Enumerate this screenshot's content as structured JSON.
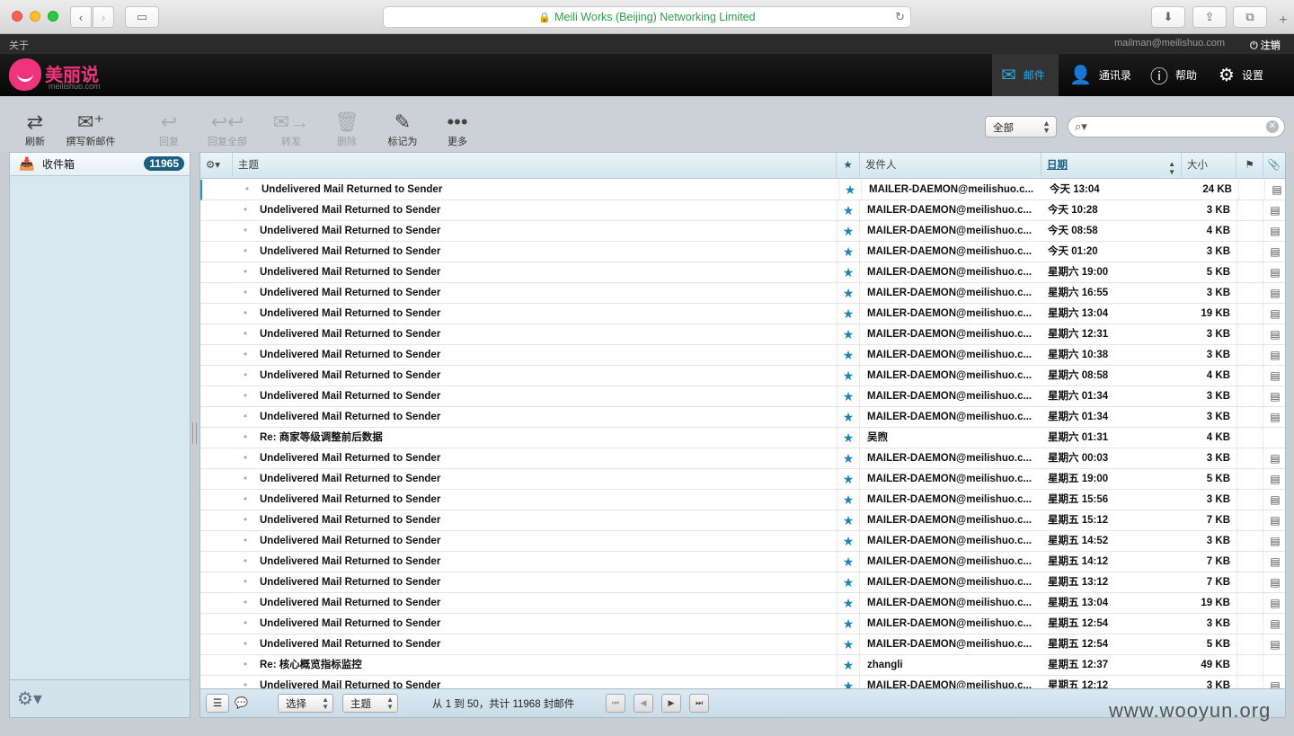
{
  "browser": {
    "url": "Meili Works (Beijing) Networking Limited",
    "back": "‹",
    "forward": "›",
    "sidebar": "▭",
    "download": "⬇",
    "share": "⇪",
    "tabs": "⧉",
    "new_tab": "+"
  },
  "account": {
    "about": "关于",
    "email": "mailman@meilishuo.com",
    "logout": "注销"
  },
  "logo": {
    "brand": "美丽说",
    "sub": "meilishuo.com"
  },
  "nav": [
    {
      "icon": "envelope-icon",
      "label": "邮件"
    },
    {
      "icon": "person-icon",
      "label": "通讯录"
    },
    {
      "icon": "help-icon",
      "label": "帮助"
    },
    {
      "icon": "gear-icon",
      "label": "设置"
    }
  ],
  "toolbar": {
    "refresh": "刷新",
    "compose": "撰写新邮件",
    "reply": "回复",
    "reply_all": "回复全部",
    "forward": "转发",
    "delete": "删除",
    "mark": "标记为",
    "more": "更多"
  },
  "filter": {
    "value": "全部"
  },
  "sidebar": {
    "folder": "收件箱",
    "count": "11965"
  },
  "list": {
    "headers": {
      "subject": "主题",
      "from": "发件人",
      "date": "日期",
      "size": "大小"
    },
    "rows": [
      {
        "subject": "Undelivered Mail Returned to Sender",
        "from": "MAILER-DAEMON@meilishuo.c...",
        "date": "今天 13:04",
        "size": "24 KB",
        "att": "▤"
      },
      {
        "subject": "Undelivered Mail Returned to Sender",
        "from": "MAILER-DAEMON@meilishuo.c...",
        "date": "今天 10:28",
        "size": "3 KB",
        "att": "▤"
      },
      {
        "subject": "Undelivered Mail Returned to Sender",
        "from": "MAILER-DAEMON@meilishuo.c...",
        "date": "今天 08:58",
        "size": "4 KB",
        "att": "▤"
      },
      {
        "subject": "Undelivered Mail Returned to Sender",
        "from": "MAILER-DAEMON@meilishuo.c...",
        "date": "今天 01:20",
        "size": "3 KB",
        "att": "▤"
      },
      {
        "subject": "Undelivered Mail Returned to Sender",
        "from": "MAILER-DAEMON@meilishuo.c...",
        "date": "星期六 19:00",
        "size": "5 KB",
        "att": "▤"
      },
      {
        "subject": "Undelivered Mail Returned to Sender",
        "from": "MAILER-DAEMON@meilishuo.c...",
        "date": "星期六 16:55",
        "size": "3 KB",
        "att": "▤"
      },
      {
        "subject": "Undelivered Mail Returned to Sender",
        "from": "MAILER-DAEMON@meilishuo.c...",
        "date": "星期六 13:04",
        "size": "19 KB",
        "att": "▤"
      },
      {
        "subject": "Undelivered Mail Returned to Sender",
        "from": "MAILER-DAEMON@meilishuo.c...",
        "date": "星期六 12:31",
        "size": "3 KB",
        "att": "▤"
      },
      {
        "subject": "Undelivered Mail Returned to Sender",
        "from": "MAILER-DAEMON@meilishuo.c...",
        "date": "星期六 10:38",
        "size": "3 KB",
        "att": "▤"
      },
      {
        "subject": "Undelivered Mail Returned to Sender",
        "from": "MAILER-DAEMON@meilishuo.c...",
        "date": "星期六 08:58",
        "size": "4 KB",
        "att": "▤"
      },
      {
        "subject": "Undelivered Mail Returned to Sender",
        "from": "MAILER-DAEMON@meilishuo.c...",
        "date": "星期六 01:34",
        "size": "3 KB",
        "att": "▤"
      },
      {
        "subject": "Undelivered Mail Returned to Sender",
        "from": "MAILER-DAEMON@meilishuo.c...",
        "date": "星期六 01:34",
        "size": "3 KB",
        "att": "▤"
      },
      {
        "subject": "Re: 商家等级调整前后数据",
        "from": "吴煦",
        "date": "星期六 01:31",
        "size": "4 KB",
        "att": ""
      },
      {
        "subject": "Undelivered Mail Returned to Sender",
        "from": "MAILER-DAEMON@meilishuo.c...",
        "date": "星期六 00:03",
        "size": "3 KB",
        "att": "▤"
      },
      {
        "subject": "Undelivered Mail Returned to Sender",
        "from": "MAILER-DAEMON@meilishuo.c...",
        "date": "星期五 19:00",
        "size": "5 KB",
        "att": "▤"
      },
      {
        "subject": "Undelivered Mail Returned to Sender",
        "from": "MAILER-DAEMON@meilishuo.c...",
        "date": "星期五 15:56",
        "size": "3 KB",
        "att": "▤"
      },
      {
        "subject": "Undelivered Mail Returned to Sender",
        "from": "MAILER-DAEMON@meilishuo.c...",
        "date": "星期五 15:12",
        "size": "7 KB",
        "att": "▤"
      },
      {
        "subject": "Undelivered Mail Returned to Sender",
        "from": "MAILER-DAEMON@meilishuo.c...",
        "date": "星期五 14:52",
        "size": "3 KB",
        "att": "▤"
      },
      {
        "subject": "Undelivered Mail Returned to Sender",
        "from": "MAILER-DAEMON@meilishuo.c...",
        "date": "星期五 14:12",
        "size": "7 KB",
        "att": "▤"
      },
      {
        "subject": "Undelivered Mail Returned to Sender",
        "from": "MAILER-DAEMON@meilishuo.c...",
        "date": "星期五 13:12",
        "size": "7 KB",
        "att": "▤"
      },
      {
        "subject": "Undelivered Mail Returned to Sender",
        "from": "MAILER-DAEMON@meilishuo.c...",
        "date": "星期五 13:04",
        "size": "19 KB",
        "att": "▤"
      },
      {
        "subject": "Undelivered Mail Returned to Sender",
        "from": "MAILER-DAEMON@meilishuo.c...",
        "date": "星期五 12:54",
        "size": "3 KB",
        "att": "▤"
      },
      {
        "subject": "Undelivered Mail Returned to Sender",
        "from": "MAILER-DAEMON@meilishuo.c...",
        "date": "星期五 12:54",
        "size": "5 KB",
        "att": "▤"
      },
      {
        "subject": "Re: 核心概览指标监控",
        "from": "zhangli",
        "date": "星期五 12:37",
        "size": "49 KB",
        "att": ""
      },
      {
        "subject": "Undelivered Mail Returned to Sender",
        "from": "MAILER-DAEMON@meilishuo.c...",
        "date": "星期五 12:12",
        "size": "3 KB",
        "att": "▤"
      }
    ]
  },
  "footer": {
    "select": "选择",
    "thread": "主题",
    "paging": "从 1 到 50，共计 11968 封邮件"
  },
  "watermark": "www.wooyun.org"
}
